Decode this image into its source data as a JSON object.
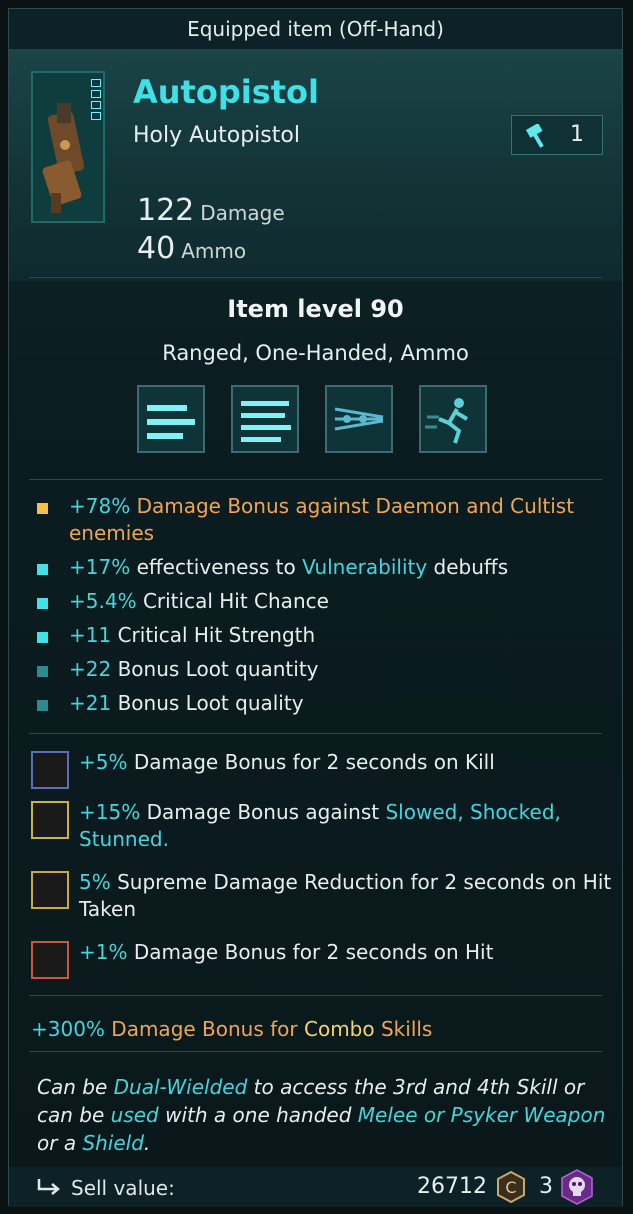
{
  "title": "Equipped item (Off-Hand)",
  "item": {
    "name": "Autopistol",
    "subtitle": "Holy Autopistol",
    "count": "1",
    "count_icon": "hammer-icon",
    "stats": [
      {
        "value": "122",
        "label": "Damage"
      },
      {
        "value": "40",
        "label": "Ammo"
      }
    ],
    "item_level": "Item level 90",
    "tags": "Ranged, One-Handed, Ammo"
  },
  "skill_icons": [
    "bullets-skill-icon-1",
    "bullets-skill-icon-2",
    "chain-skill-icon",
    "dash-skill-icon"
  ],
  "mods": [
    {
      "bullet_color": "#f5c04a",
      "parts": [
        {
          "t": "+78% ",
          "c": "cyan"
        },
        {
          "t": "Damage Bonus against Daemon and Cultist enemies",
          "c": "orange"
        }
      ]
    },
    {
      "bullet_color": "#43e0e8",
      "parts": [
        {
          "t": "+17% ",
          "c": "cyan"
        },
        {
          "t": "effectiveness to ",
          "c": "white"
        },
        {
          "t": "Vulnerability",
          "c": "cyan"
        },
        {
          "t": " debuffs",
          "c": "white"
        }
      ]
    },
    {
      "bullet_color": "#43e0e8",
      "parts": [
        {
          "t": "+5.4% ",
          "c": "cyan"
        },
        {
          "t": "Critical Hit Chance",
          "c": "white"
        }
      ]
    },
    {
      "bullet_color": "#43e0e8",
      "parts": [
        {
          "t": "+11 ",
          "c": "cyan"
        },
        {
          "t": "Critical Hit Strength",
          "c": "white"
        }
      ]
    },
    {
      "bullet_color": "#2e8a8e",
      "parts": [
        {
          "t": "+22 ",
          "c": "cyan"
        },
        {
          "t": "Bonus Loot quantity",
          "c": "white"
        }
      ]
    },
    {
      "bullet_color": "#2e8a8e",
      "parts": [
        {
          "t": "+21 ",
          "c": "cyan"
        },
        {
          "t": "Bonus Loot quality",
          "c": "white"
        }
      ]
    }
  ],
  "blessings": [
    {
      "badge_color": "#5a6fb8",
      "parts": [
        {
          "t": "+5% ",
          "c": "cyan"
        },
        {
          "t": "Damage Bonus for 2 seconds on Kill",
          "c": "white"
        }
      ]
    },
    {
      "badge_color": "#c9b24a",
      "parts": [
        {
          "t": "+15% ",
          "c": "cyan"
        },
        {
          "t": "Damage Bonus against ",
          "c": "white"
        },
        {
          "t": "Slowed, Shocked, Stunned.",
          "c": "cyan"
        }
      ]
    },
    {
      "badge_color": "#c9a84a",
      "parts": [
        {
          "t": "5% ",
          "c": "cyan"
        },
        {
          "t": "Supreme Damage Reduction for 2 seconds on Hit Taken",
          "c": "white"
        }
      ]
    },
    {
      "badge_color": "#c9583a",
      "parts": [
        {
          "t": "+1% ",
          "c": "cyan"
        },
        {
          "t": "Damage Bonus for 2 seconds on Hit",
          "c": "white"
        }
      ]
    }
  ],
  "combo": [
    {
      "t": "+300% ",
      "c": "cyan"
    },
    {
      "t": "Damage Bonus for ",
      "c": "orange"
    },
    {
      "t": "Combo",
      "c": "yellow"
    },
    {
      "t": " Skills",
      "c": "orange"
    }
  ],
  "description": [
    {
      "t": "Can be ",
      "c": "white"
    },
    {
      "t": "Dual-Wielded",
      "c": "cyan"
    },
    {
      "t": " to access the 3rd and 4th Skill or can be ",
      "c": "white"
    },
    {
      "t": "used",
      "c": "cyan"
    },
    {
      "t": " with a one handed ",
      "c": "white"
    },
    {
      "t": "Melee or Psyker Weapon",
      "c": "cyan"
    },
    {
      "t": " or a ",
      "c": "white"
    },
    {
      "t": "Shield",
      "c": "cyan"
    },
    {
      "t": ".",
      "c": "white"
    }
  ],
  "footer": {
    "sell_label": "Sell value:",
    "price": "26712",
    "currency2_count": "3",
    "sell_icon": "return-arrow-icon",
    "currency_icon": "coin-icon",
    "currency2_icon": "skull-icon"
  }
}
